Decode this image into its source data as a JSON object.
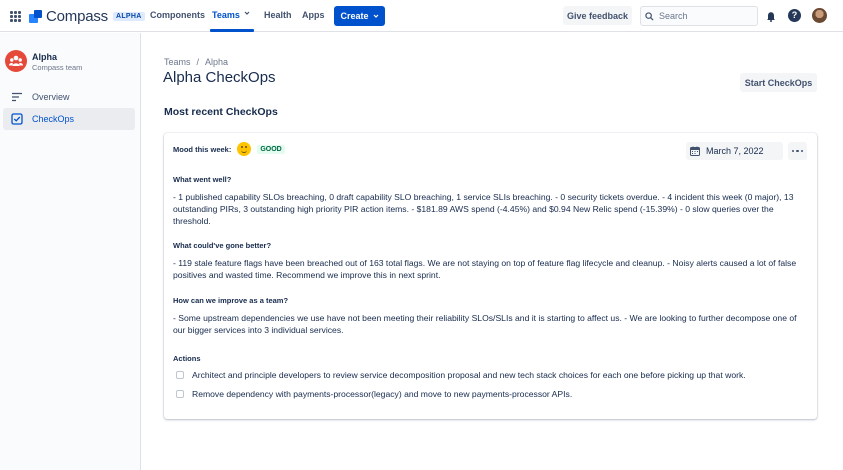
{
  "header": {
    "app_name": "Compass",
    "badge": "ALPHA",
    "nav": {
      "components": "Components",
      "teams": "Teams",
      "health": "Health",
      "apps": "Apps"
    },
    "create_label": "Create",
    "feedback_label": "Give feedback",
    "search_placeholder": "Search"
  },
  "sidebar": {
    "team_name": "Alpha",
    "team_sub": "Compass team",
    "items": [
      {
        "label": "Overview",
        "icon": "overview-icon"
      },
      {
        "label": "CheckOps",
        "icon": "checkbox-icon",
        "active": true
      }
    ]
  },
  "main": {
    "breadcrumb": [
      "Teams",
      "/",
      "Alpha"
    ],
    "title": "Alpha CheckOps",
    "start_label": "Start CheckOps",
    "section_title": "Most recent CheckOps",
    "card": {
      "mood_label": "Mood this week:",
      "mood_value": "GOOD",
      "date": "March 7, 2022",
      "q1": "What went well?",
      "a1": "- 1 published capability SLOs breaching, 0 draft capability SLO breaching, 1 service SLIs breaching. - 0 security tickets overdue. - 4 incident this week (0 major), 13 outstanding PIRs, 3 outstanding high priority PIR action items. - $181.89 AWS spend (-4.45%) and $0.94 New Relic spend (-15.39%) - 0 slow queries over the threshold.",
      "q2": "What could've gone better?",
      "a2": "- 119 stale feature flags have been breached out of 163 total flags. We are not staying on top of feature flag lifecycle and cleanup. - Noisy alerts caused a lot of false positives and wasted time. Recommend we improve this in next sprint.",
      "q3": "How can we improve as a team?",
      "a3": "- Some upstream dependencies we use have not been meeting their reliability SLOs/SLIs and it is starting to affect us. - We are looking to further decompose one of our bigger services into 3 individual services.",
      "actions_label": "Actions",
      "actions": [
        "Architect and principle developers to review service decomposition proposal and new tech stack choices for each one before picking up that work.",
        "Remove dependency with payments-processor(legacy) and move to new payments-processor APIs."
      ]
    }
  },
  "colors": {
    "brand": "#0052cc",
    "team_avatar": "#e5493a",
    "good_badge_bg": "#e3fcef",
    "good_badge_text": "#006644"
  }
}
